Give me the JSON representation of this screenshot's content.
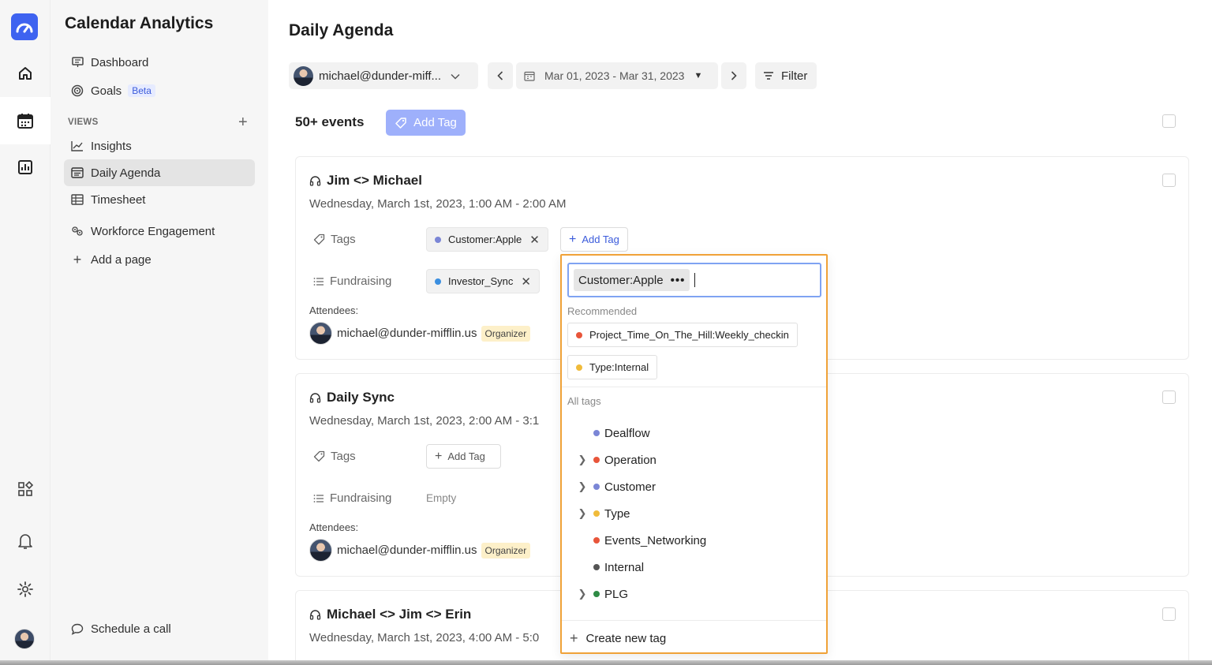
{
  "app": {
    "title": "Calendar Analytics"
  },
  "sidebar": {
    "items": [
      {
        "label": "Dashboard",
        "icon": "presentation-icon"
      },
      {
        "label": "Goals",
        "badge": "Beta",
        "icon": "target-icon"
      }
    ],
    "views_label": "VIEWS",
    "views": [
      {
        "label": "Insights",
        "icon": "chart-line-icon"
      },
      {
        "label": "Daily Agenda",
        "icon": "agenda-icon",
        "active": true
      },
      {
        "label": "Timesheet",
        "icon": "table-icon"
      },
      {
        "label": "Workforce Engagement",
        "icon": "engagement-icon"
      },
      {
        "label": "Add a page",
        "icon": "plus-icon"
      }
    ],
    "schedule_label": "Schedule a call"
  },
  "page": {
    "title": "Daily Agenda",
    "user_select": "michael@dunder-miff...",
    "date_range": "Mar 01, 2023 - Mar 31, 2023",
    "filter_label": "Filter",
    "events_count": "50+ events",
    "add_tag_label": "Add Tag"
  },
  "events": [
    {
      "title": "Jim <> Michael",
      "time": "Wednesday, March 1st, 2023, 1:00 AM - 2:00 AM",
      "tags_label": "Tags",
      "tags": [
        {
          "label": "Customer:Apple",
          "color": "#7b86d6"
        }
      ],
      "add_tag": "Add Tag",
      "fundraising_label": "Fundraising",
      "fundraising": [
        {
          "label": "Investor_Sync",
          "color": "#3b8fe0"
        }
      ],
      "attendees_label": "Attendees:",
      "attendee": "michael@dunder-mifflin.us",
      "organizer": "Organizer"
    },
    {
      "title": "Daily Sync",
      "time": "Wednesday, March 1st, 2023, 2:00 AM - 3:1",
      "tags_label": "Tags",
      "add_tag": "Add Tag",
      "fundraising_label": "Fundraising",
      "fundraising_empty": "Empty",
      "attendees_label": "Attendees:",
      "attendee": "michael@dunder-mifflin.us",
      "organizer": "Organizer"
    },
    {
      "title": "Michael <> Jim <> Erin",
      "time": "Wednesday, March 1st, 2023, 4:00 AM - 5:0"
    }
  ],
  "tag_dropdown": {
    "selected": "Customer:Apple",
    "more": "•••",
    "recommended_label": "Recommended",
    "recommended": [
      {
        "label": "Project_Time_On_The_Hill:Weekly_checkin",
        "color": "#e8553a"
      },
      {
        "label": "Type:Internal",
        "color": "#f0bb3a"
      }
    ],
    "all_tags_label": "All tags",
    "all_tags": [
      {
        "label": "Dealflow",
        "color": "#7b86d6",
        "expandable": false
      },
      {
        "label": "Operation",
        "color": "#e8553a",
        "expandable": true
      },
      {
        "label": "Customer",
        "color": "#7b86d6",
        "expandable": true
      },
      {
        "label": "Type",
        "color": "#f0bb3a",
        "expandable": true
      },
      {
        "label": "Events_Networking",
        "color": "#e8553a",
        "expandable": false
      },
      {
        "label": "Internal",
        "color": "#555555",
        "expandable": false
      },
      {
        "label": "PLG",
        "color": "#2e8b45",
        "expandable": true
      }
    ],
    "create_label": "Create new tag"
  },
  "colors": {
    "accent": "#3e63f0",
    "highlight": "#f0a238",
    "add_tag_bg": "#9eb0fb"
  }
}
